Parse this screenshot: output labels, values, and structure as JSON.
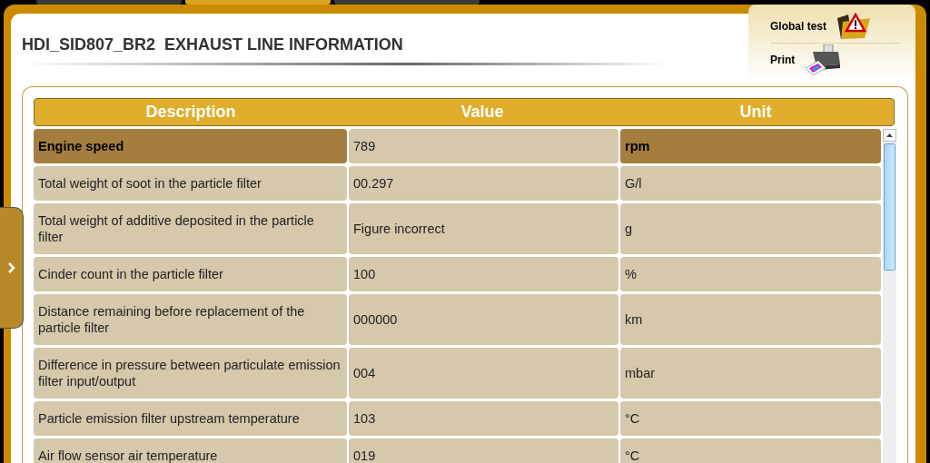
{
  "window": {
    "title": "HDI_SID807_BR2  EXHAUST LINE INFORMATION"
  },
  "top_tabs": [
    {
      "selected": false
    },
    {
      "selected": true
    },
    {
      "selected": false
    }
  ],
  "actions": [
    {
      "label": "Global test",
      "kind": "warning"
    },
    {
      "label": "Print",
      "kind": "printer"
    }
  ],
  "table": {
    "columns": [
      "Description",
      "Value",
      "Unit"
    ],
    "rows": [
      {
        "cells": [
          "Engine speed",
          "789",
          "rpm"
        ],
        "selected": true
      },
      {
        "cells": [
          "Total weight of soot in the particle filter",
          "00.297",
          "G/l"
        ],
        "selected": false
      },
      {
        "cells": [
          "Total weight of additive deposited in the particle filter",
          "Figure incorrect",
          "g"
        ],
        "selected": false
      },
      {
        "cells": [
          "Cinder count in the particle filter",
          "100",
          "%"
        ],
        "selected": false
      },
      {
        "cells": [
          "Distance remaining before replacement of the particle filter",
          "000000",
          "km"
        ],
        "selected": false
      },
      {
        "cells": [
          "Difference in pressure between particulate emission filter input/output",
          "004",
          "mbar"
        ],
        "selected": false
      },
      {
        "cells": [
          "Particle emission filter upstream temperature",
          "103",
          "°C"
        ],
        "selected": false
      },
      {
        "cells": [
          "Air flow sensor air temperature",
          "019",
          "°C"
        ],
        "selected": false
      }
    ]
  }
}
